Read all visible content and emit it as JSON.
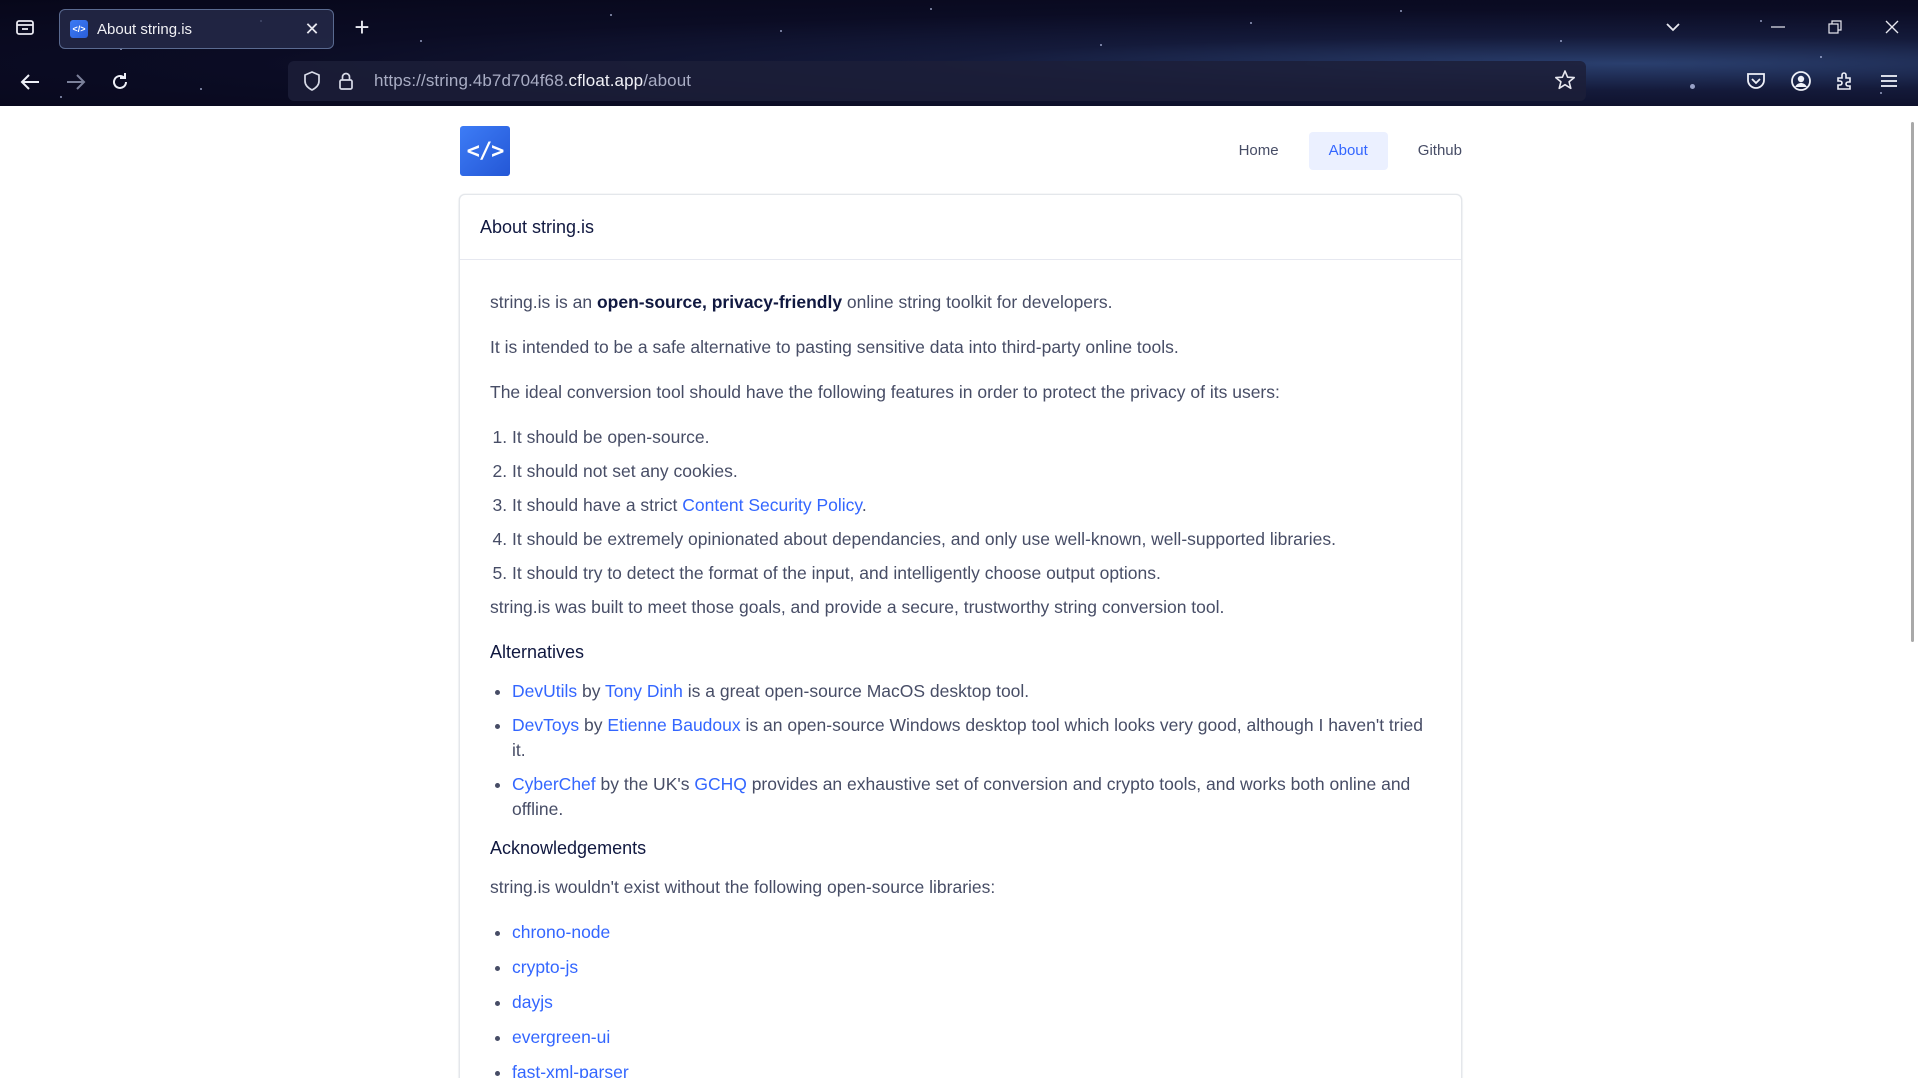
{
  "browser": {
    "tab_title": "About string.is",
    "tab_favicon": "</>",
    "url_prefix": "https://string.4b7d704f68.",
    "url_domain": "cfloat.app",
    "url_path": "/about"
  },
  "site": {
    "logo_text": "</>",
    "nav": [
      {
        "label": "Home"
      },
      {
        "label": "About"
      },
      {
        "label": "Github"
      }
    ]
  },
  "card": {
    "heading": "About string.is"
  },
  "about": {
    "intro": {
      "pre": "string.is is an ",
      "bold": "open-source, privacy-friendly",
      "post": " online string toolkit for developers."
    },
    "p2": "It is intended to be a safe alternative to pasting sensitive data into third-party online tools.",
    "p3": "The ideal conversion tool should have the following features in order to protect the privacy of its users:",
    "features": {
      "f1": "It should be open-source.",
      "f2": "It should not set any cookies.",
      "f3_pre": "It should have a strict ",
      "f3_link": "Content Security Policy",
      "f3_post": ".",
      "f4": "It should be extremely opinionated about dependancies, and only use well-known, well-supported libraries.",
      "f5": "It should try to detect the format of the input, and intelligently choose output options."
    },
    "p4": "string.is was built to meet those goals, and provide a secure, trustworthy string conversion tool.",
    "alternatives_heading": "Alternatives",
    "alternatives": {
      "a1_tool": "DevUtils",
      "a1_by": " by ",
      "a1_author": "Tony Dinh",
      "a1_rest": " is a great open-source MacOS desktop tool.",
      "a2_tool": "DevToys",
      "a2_by": " by ",
      "a2_author": "Etienne Baudoux",
      "a2_rest": " is an open-source Windows desktop tool which looks very good, although I haven't tried it.",
      "a3_tool": "CyberChef",
      "a3_by": " by the UK's ",
      "a3_author": "GCHQ",
      "a3_rest": " provides an exhaustive set of conversion and crypto tools, and works both online and offline."
    },
    "ack_heading": "Acknowledgements",
    "ack_text": "string.is wouldn't exist without the following open-source libraries:",
    "libraries": [
      "chrono-node",
      "crypto-js",
      "dayjs",
      "evergreen-ui",
      "fast-xml-parser"
    ]
  }
}
